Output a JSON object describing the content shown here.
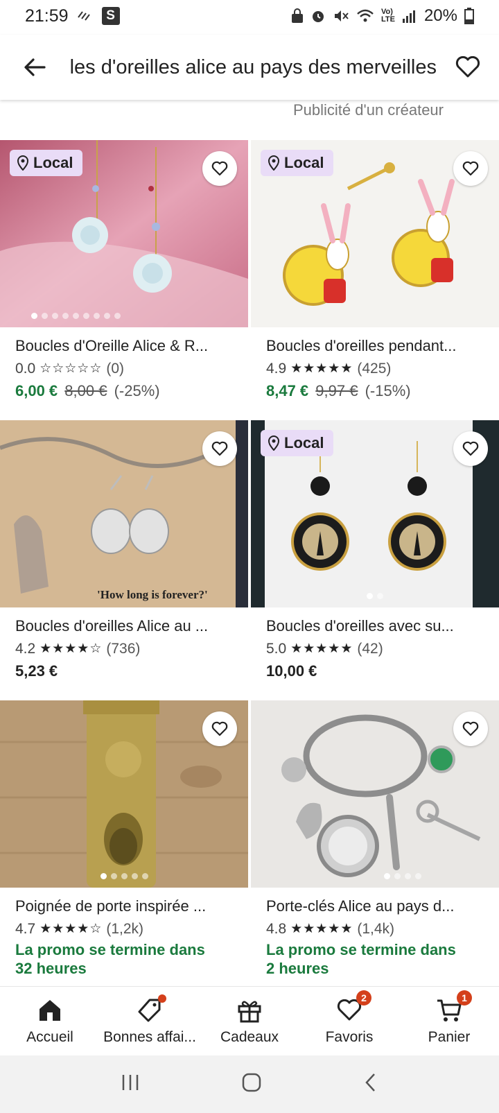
{
  "status_bar": {
    "time": "21:59",
    "app_letter": "S",
    "battery": "20%"
  },
  "header": {
    "title": "Boucles d'oreilles alice au pays des merveilles"
  },
  "ad_label": "Publicité d'un créateur",
  "products": [
    {
      "title": "Boucles d'Oreille Alice & R...",
      "rating": "0.0",
      "stars": "☆☆☆☆☆",
      "reviews": "(0)",
      "price": "6,00 €",
      "original_price": "8,00 €",
      "discount": "(-25%)",
      "local": "Local"
    },
    {
      "title": "Boucles d'oreilles pendant...",
      "rating": "4.9",
      "stars": "★★★★★",
      "reviews": "(425)",
      "price": "8,47 €",
      "original_price": "9,97 €",
      "discount": "(-15%)",
      "local": "Local"
    },
    {
      "title": "Boucles d'oreilles Alice au ...",
      "rating": "4.2",
      "stars": "★★★★☆",
      "reviews": "(736)",
      "price": "5,23 €"
    },
    {
      "title": "Boucles d'oreilles avec su...",
      "rating": "5.0",
      "stars": "★★★★★",
      "reviews": "(42)",
      "price": "10,00 €",
      "local": "Local"
    },
    {
      "title": "Poignée de porte inspirée ...",
      "rating": "4.7",
      "stars": "★★★★☆",
      "reviews": "(1,2k)",
      "promo_line1": "La promo se termine dans",
      "promo_line2": "32 heures"
    },
    {
      "title": "Porte-clés Alice au pays d...",
      "rating": "4.8",
      "stars": "★★★★★",
      "reviews": "(1,4k)",
      "promo_line1": "La promo se termine dans",
      "promo_line2": "2 heures"
    }
  ],
  "image_text": {
    "book_caption": "'How long is forever?'"
  },
  "bottom_nav": [
    {
      "label": "Accueil",
      "icon": "home-icon"
    },
    {
      "label": "Bonnes affai...",
      "icon": "tag-icon"
    },
    {
      "label": "Cadeaux",
      "icon": "gift-icon"
    },
    {
      "label": "Favoris",
      "icon": "heart-icon",
      "badge": "2"
    },
    {
      "label": "Panier",
      "icon": "cart-icon",
      "badge": "1"
    }
  ],
  "colors": {
    "sale_green": "#1a7a3d",
    "badge_red": "#d4401b",
    "local_badge_bg": "#e9dcf7"
  }
}
